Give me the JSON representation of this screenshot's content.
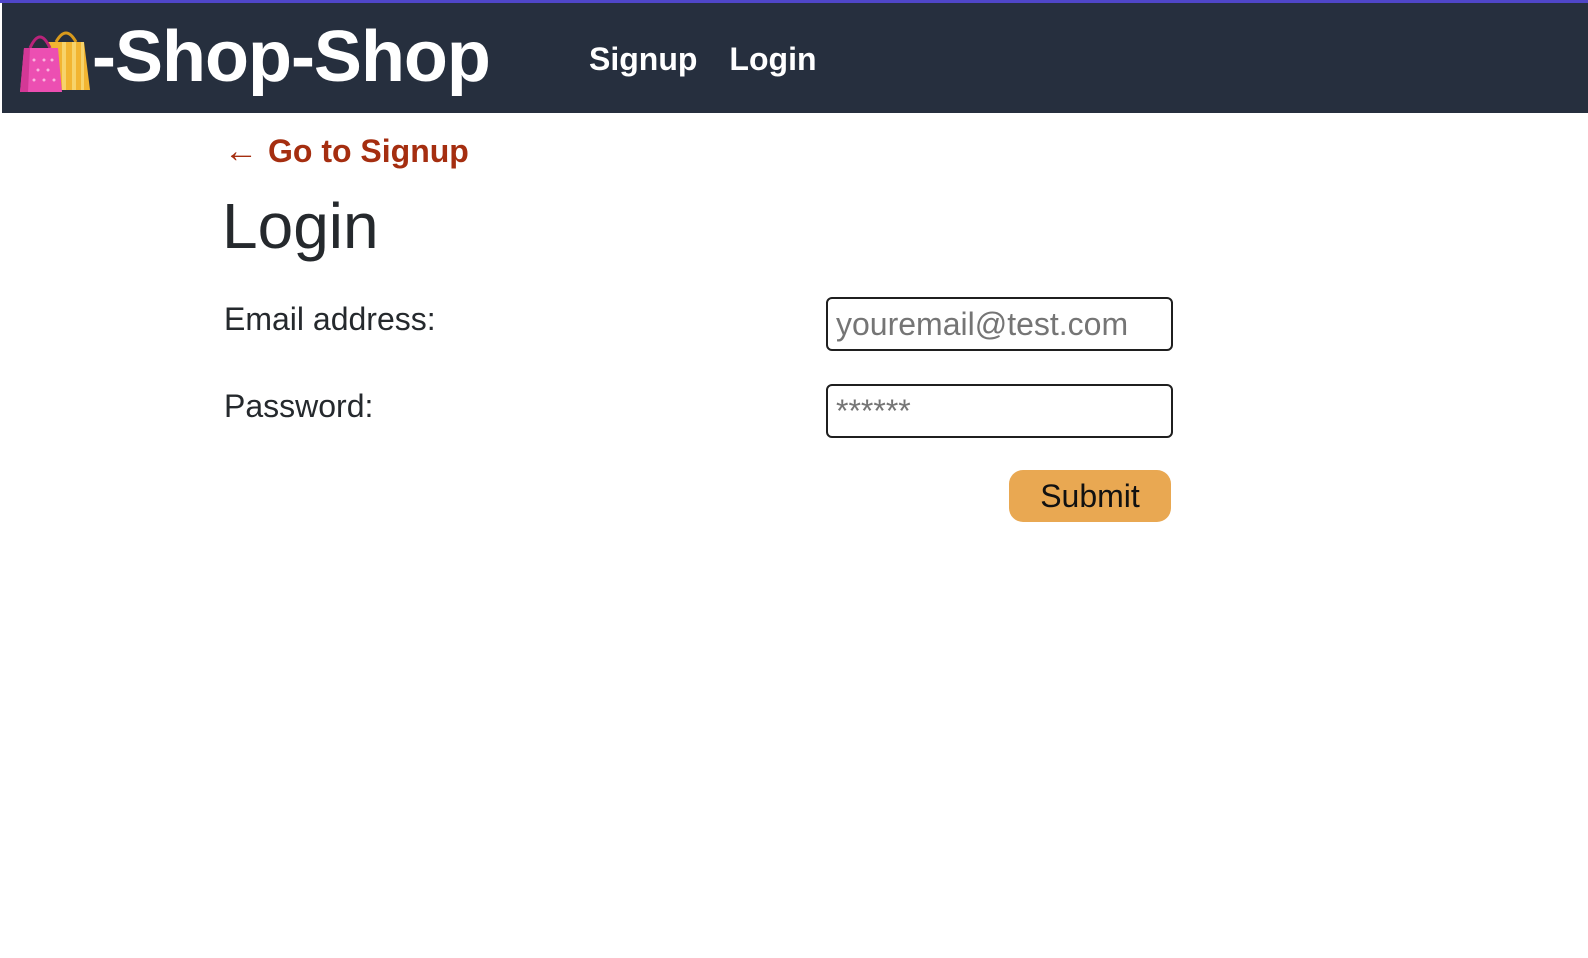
{
  "colors": {
    "accent_strip": "#4f46c8",
    "header_bg": "#262f3e",
    "link": "#a52e10",
    "button": "#e9a852"
  },
  "header": {
    "logo_icon": "shopping-bags-icon",
    "brand": "-Shop-Shop",
    "nav": [
      {
        "label": "Signup"
      },
      {
        "label": "Login"
      }
    ]
  },
  "main": {
    "back_link": {
      "arrow": "←",
      "label": "Go to Signup"
    },
    "title": "Login",
    "email": {
      "label": "Email address:",
      "placeholder": "youremail@test.com",
      "value": ""
    },
    "password": {
      "label": "Password:",
      "placeholder": "******",
      "value": ""
    },
    "submit_label": "Submit"
  }
}
